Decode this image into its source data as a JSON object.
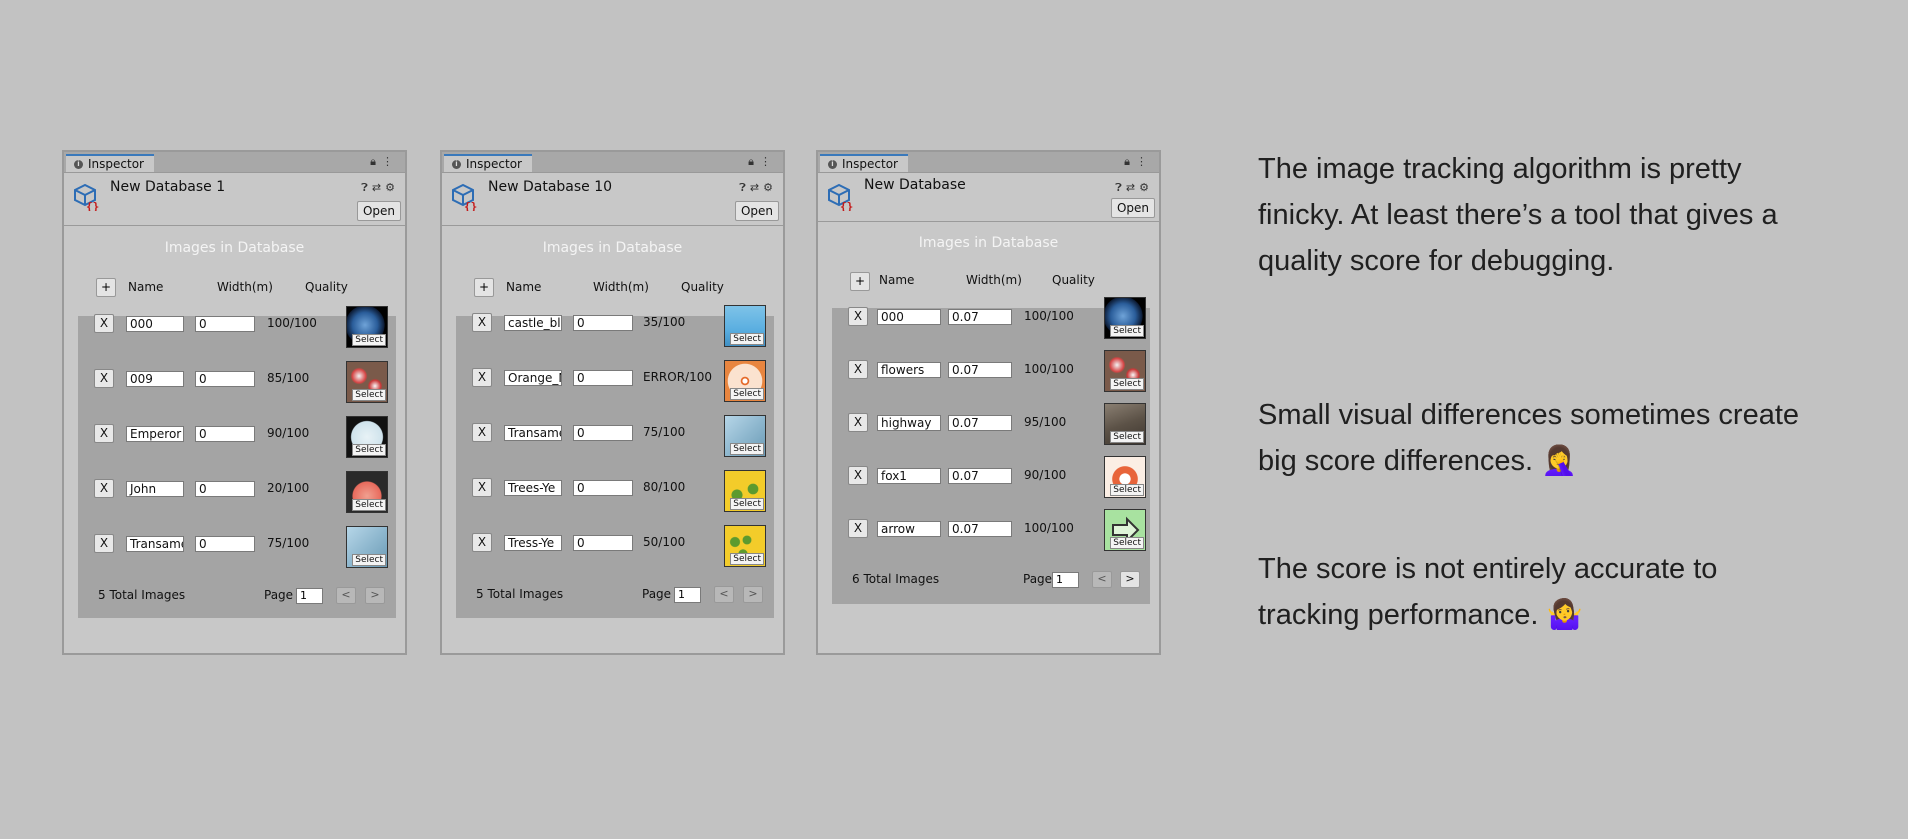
{
  "panels": [
    {
      "tab": "Inspector",
      "db_name": "New Database 1",
      "open_label": "Open",
      "section_title": "Images in Database",
      "cols": {
        "add": "+",
        "name": "Name",
        "width": "Width(m)",
        "quality": "Quality"
      },
      "rows": [
        {
          "x": "X",
          "name": "000",
          "width": "0",
          "quality": "100/100",
          "thumb": "earth",
          "select": "Select"
        },
        {
          "x": "X",
          "name": "009",
          "width": "0",
          "quality": "85/100",
          "thumb": "flowers",
          "select": "Select"
        },
        {
          "x": "X",
          "name": "Emperor",
          "width": "0",
          "quality": "90/100",
          "thumb": "emperor",
          "select": "Select"
        },
        {
          "x": "X",
          "name": "John",
          "width": "0",
          "quality": "20/100",
          "thumb": "john",
          "select": "Select"
        },
        {
          "x": "X",
          "name": "Transame",
          "width": "0",
          "quality": "75/100",
          "thumb": "transamerica",
          "select": "Select"
        }
      ],
      "total": "5 Total Images",
      "page_label": "Page",
      "page": "1",
      "prev": "<",
      "next": ">"
    },
    {
      "tab": "Inspector",
      "db_name": "New Database 10",
      "open_label": "Open",
      "section_title": "Images in Database",
      "cols": {
        "add": "+",
        "name": "Name",
        "width": "Width(m)",
        "quality": "Quality"
      },
      "rows": [
        {
          "x": "X",
          "name": "castle_blu",
          "width": "0",
          "quality": "35/100",
          "thumb": "castle",
          "select": "Select"
        },
        {
          "x": "X",
          "name": "Orange_N",
          "width": "0",
          "quality": "ERROR/100",
          "thumb": "orange",
          "select": "Select"
        },
        {
          "x": "X",
          "name": "Transame",
          "width": "0",
          "quality": "75/100",
          "thumb": "transamerica",
          "select": "Select"
        },
        {
          "x": "X",
          "name": "Trees-Ye",
          "width": "0",
          "quality": "80/100",
          "thumb": "trees",
          "select": "Select"
        },
        {
          "x": "X",
          "name": "Tress-Ye",
          "width": "0",
          "quality": "50/100",
          "thumb": "trees",
          "select": "Select"
        }
      ],
      "total": "5 Total Images",
      "page_label": "Page",
      "page": "1",
      "prev": "<",
      "next": ">"
    },
    {
      "tab": "Inspector",
      "db_name": "New Database",
      "open_label": "Open",
      "section_title": "Images in Database",
      "cols": {
        "add": "+",
        "name": "Name",
        "width": "Width(m)",
        "quality": "Quality"
      },
      "rows": [
        {
          "x": "X",
          "name": "000",
          "width": "0.07",
          "quality": "100/100",
          "thumb": "earth",
          "select": "Select"
        },
        {
          "x": "X",
          "name": "flowers",
          "width": "0.07",
          "quality": "100/100",
          "thumb": "flowers",
          "select": "Select"
        },
        {
          "x": "X",
          "name": "highway",
          "width": "0.07",
          "quality": "95/100",
          "thumb": "highway",
          "select": "Select"
        },
        {
          "x": "X",
          "name": "fox1",
          "width": "0.07",
          "quality": "90/100",
          "thumb": "fox",
          "select": "Select"
        },
        {
          "x": "X",
          "name": "arrow",
          "width": "0.07",
          "quality": "100/100",
          "thumb": "arrow",
          "select": "Select"
        }
      ],
      "total": "6 Total Images",
      "page_label": "Page",
      "page": "1",
      "prev": "<",
      "next": ">"
    }
  ],
  "notes": [
    "The image tracking algorithm is pretty finicky. At least there’s a tool that gives a quality score for debugging.",
    "Small visual differences sometimes create big score differences. 🤦‍♀️",
    "The score is not entirely accurate to tracking performance. 🤷‍♀️"
  ]
}
